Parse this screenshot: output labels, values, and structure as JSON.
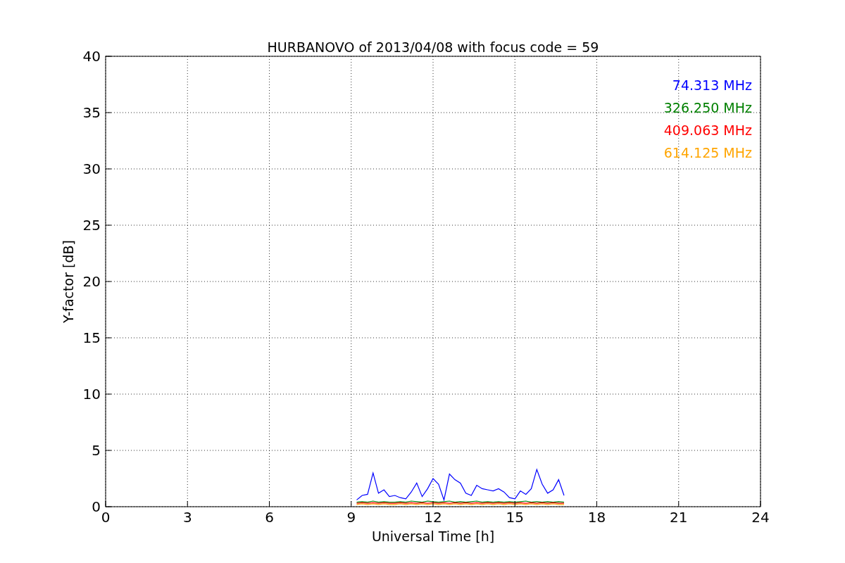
{
  "chart_data": {
    "type": "line",
    "title": "HURBANOVO of 2013/04/08 with focus code = 59",
    "xlabel": "Universal Time [h]",
    "ylabel": "Y-factor [dB]",
    "x": [
      9.2,
      9.4,
      9.6,
      9.8,
      10.0,
      10.2,
      10.4,
      10.6,
      10.8,
      11.0,
      11.2,
      11.4,
      11.6,
      11.8,
      12.0,
      12.2,
      12.4,
      12.6,
      12.8,
      13.0,
      13.2,
      13.4,
      13.6,
      13.8,
      14.0,
      14.2,
      14.4,
      14.6,
      14.8,
      15.0,
      15.2,
      15.4,
      15.6,
      15.8,
      16.0,
      16.2,
      16.4,
      16.6,
      16.8
    ],
    "series": [
      {
        "name": "74.313 MHz",
        "color": "#0000ff",
        "values": [
          0.6,
          1.0,
          1.1,
          3.0,
          1.2,
          1.5,
          0.9,
          1.0,
          0.8,
          0.7,
          1.3,
          2.1,
          0.9,
          1.6,
          2.5,
          2.0,
          0.6,
          2.9,
          2.4,
          2.1,
          1.2,
          1.0,
          1.9,
          1.6,
          1.5,
          1.4,
          1.6,
          1.3,
          0.8,
          0.7,
          1.4,
          1.1,
          1.6,
          3.3,
          2.0,
          1.2,
          1.5,
          2.4,
          1.0
        ]
      },
      {
        "name": "326.250 MHz",
        "color": "#008000",
        "values": [
          0.4,
          0.45,
          0.4,
          0.5,
          0.4,
          0.45,
          0.4,
          0.4,
          0.45,
          0.4,
          0.5,
          0.45,
          0.4,
          0.5,
          0.45,
          0.4,
          0.45,
          0.5,
          0.4,
          0.45,
          0.4,
          0.45,
          0.5,
          0.4,
          0.45,
          0.4,
          0.45,
          0.4,
          0.45,
          0.4,
          0.45,
          0.5,
          0.4,
          0.45,
          0.4,
          0.45,
          0.4,
          0.45,
          0.4
        ]
      },
      {
        "name": "409.063 MHz",
        "color": "#ff0000",
        "values": [
          0.3,
          0.35,
          0.3,
          0.35,
          0.3,
          0.35,
          0.3,
          0.3,
          0.35,
          0.3,
          0.35,
          0.3,
          0.35,
          0.3,
          0.35,
          0.3,
          0.35,
          0.3,
          0.35,
          0.3,
          0.35,
          0.3,
          0.35,
          0.3,
          0.35,
          0.3,
          0.35,
          0.3,
          0.35,
          0.3,
          0.35,
          0.3,
          0.35,
          0.3,
          0.35,
          0.3,
          0.35,
          0.3,
          0.3
        ]
      },
      {
        "name": "614.125 MHz",
        "color": "#ffa500",
        "values": [
          0.2,
          0.25,
          0.2,
          0.25,
          0.2,
          0.25,
          0.2,
          0.2,
          0.25,
          0.2,
          0.25,
          0.2,
          0.25,
          0.2,
          0.25,
          0.2,
          0.25,
          0.2,
          0.25,
          0.2,
          0.25,
          0.2,
          0.25,
          0.2,
          0.25,
          0.2,
          0.25,
          0.2,
          0.25,
          0.2,
          0.25,
          0.2,
          0.25,
          0.2,
          0.25,
          0.2,
          0.25,
          0.2,
          0.2
        ]
      }
    ],
    "grid": true,
    "xlim": [
      0,
      24
    ],
    "ylim": [
      0,
      40
    ],
    "xticks": [
      0,
      3,
      6,
      9,
      12,
      15,
      18,
      21,
      24
    ],
    "yticks": [
      0,
      5,
      10,
      15,
      20,
      25,
      30,
      35,
      40
    ]
  }
}
